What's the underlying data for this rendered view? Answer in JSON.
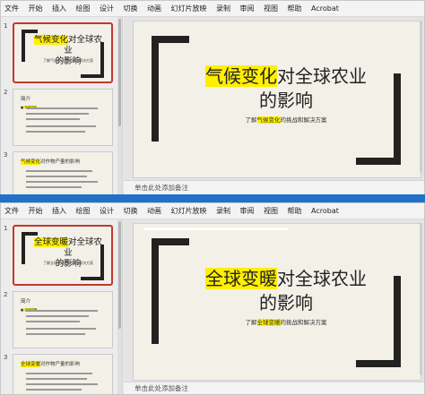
{
  "menu": [
    "文件",
    "开始",
    "插入",
    "绘图",
    "设计",
    "切换",
    "动画",
    "幻灯片放映",
    "录制",
    "审阅",
    "视图",
    "帮助",
    "Acrobat"
  ],
  "notes_placeholder": "单击此处添加备注",
  "colors": {
    "highlight": "#ffef00",
    "divider": "#1e73c9",
    "selected_border": "#c0392b",
    "slide_bg": "#f3f0e8"
  },
  "icons": [],
  "top": {
    "slide_numbers": [
      "1",
      "2",
      "3"
    ],
    "thumb1": {
      "title_hl": "气候变化",
      "title_rest": "对全球农业",
      "title_line2": "的影响",
      "subtitle": "了解气候变化的挑战和解决方案"
    },
    "thumb2": {
      "heading": "简介",
      "bullet1": "气候变化",
      "bullet2": "",
      "bullet3": ""
    },
    "thumb3": {
      "heading_hl": "气候变化",
      "heading_rest": "对作物产量的影响"
    },
    "slide": {
      "title_hl": "气候变化",
      "title_rest": "对全球农业",
      "title_line2": "的影响",
      "subtitle_pre": "了解",
      "subtitle_hl": "气候变化",
      "subtitle_post": "的挑战和解决方案"
    }
  },
  "bottom": {
    "slide_numbers": [
      "1",
      "2",
      "3"
    ],
    "thumb1": {
      "title_hl": "全球变暖",
      "title_rest": "对全球农业",
      "title_line2": "的影响",
      "subtitle": "了解全球变暖的挑战和解决方案"
    },
    "thumb2": {
      "heading": "简介",
      "bullet1": "全球变暖",
      "bullet2": "",
      "bullet3": ""
    },
    "thumb3": {
      "heading_hl": "全球变暖",
      "heading_rest": "对作物产量的影响"
    },
    "slide": {
      "title_hl": "全球变暖",
      "title_rest": "对全球农业",
      "title_line2": "的影响",
      "subtitle_pre": "了解",
      "subtitle_hl": "全球变暖",
      "subtitle_post": "的挑战和解决方案"
    }
  }
}
